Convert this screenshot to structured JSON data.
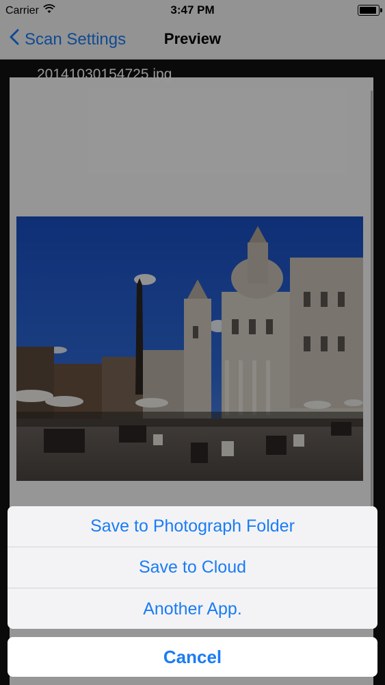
{
  "status_bar": {
    "carrier": "Carrier",
    "time": "3:47 PM"
  },
  "navbar": {
    "back_label": "Scan Settings",
    "title": "Preview"
  },
  "preview": {
    "filename": "20141030154725.jpg"
  },
  "action_sheet": {
    "options": [
      "Save to Photograph Folder",
      "Save to Cloud",
      "Another App."
    ],
    "cancel": "Cancel"
  },
  "colors": {
    "accent": "#1a7cf5"
  }
}
